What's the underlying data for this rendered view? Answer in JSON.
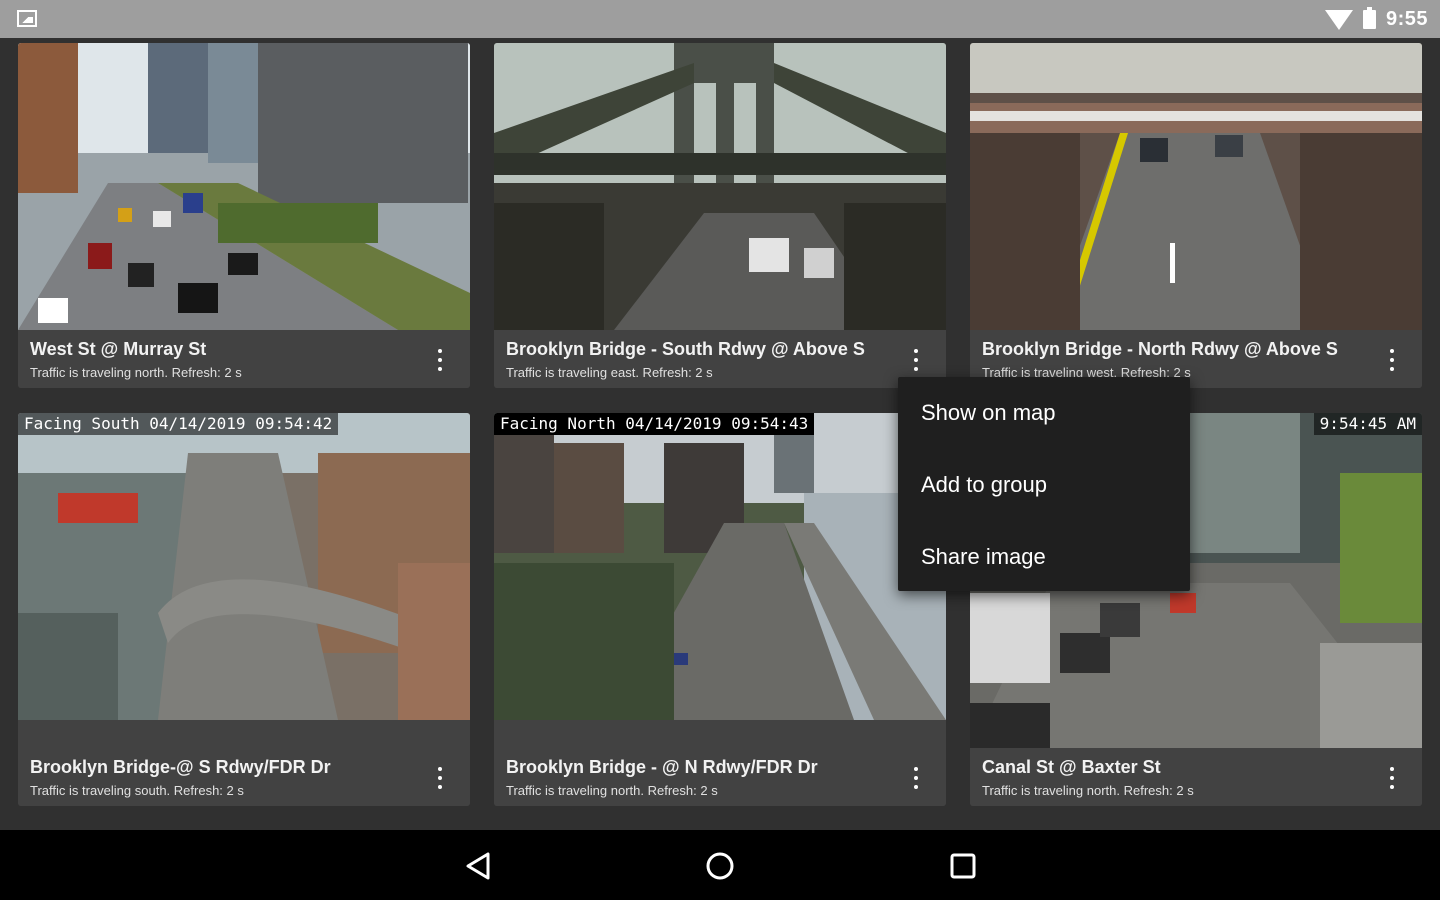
{
  "status_bar": {
    "time": "9:55",
    "icons": [
      "image-notification-icon",
      "wifi-icon",
      "battery-icon"
    ]
  },
  "cameras": [
    {
      "title": "West St @ Murray St",
      "subtitle": "Traffic is traveling north. Refresh: 2 s",
      "overlay": ""
    },
    {
      "title": "Brooklyn Bridge - South Rdwy @ Above S",
      "subtitle": "Traffic is traveling east. Refresh: 2 s",
      "overlay": ""
    },
    {
      "title": "Brooklyn Bridge - North Rdwy @ Above S",
      "subtitle": "Traffic is traveling west. Refresh: 2 s",
      "overlay": ""
    },
    {
      "title": "Brooklyn Bridge-@ S Rdwy/FDR Dr",
      "subtitle": "Traffic is traveling south. Refresh: 2 s",
      "overlay": "Facing South 04/14/2019 09:54:42"
    },
    {
      "title": "Brooklyn Bridge - @ N Rdwy/FDR Dr",
      "subtitle": "Traffic is traveling north. Refresh: 2 s",
      "overlay": "Facing North 04/14/2019 09:54:43"
    },
    {
      "title": "Canal St @ Baxter St",
      "subtitle": "Traffic is traveling north. Refresh: 2 s",
      "overlay": "9:54:45 AM"
    }
  ],
  "popup_menu": {
    "items": [
      "Show on map",
      "Add to group",
      "Share image"
    ]
  },
  "nav_bar": {
    "buttons": [
      "back-icon",
      "home-icon",
      "recents-icon"
    ]
  },
  "colors": {
    "background": "#303030",
    "card": "#424242",
    "status_bar": "#9e9e9e",
    "menu": "#1f1f1f"
  }
}
